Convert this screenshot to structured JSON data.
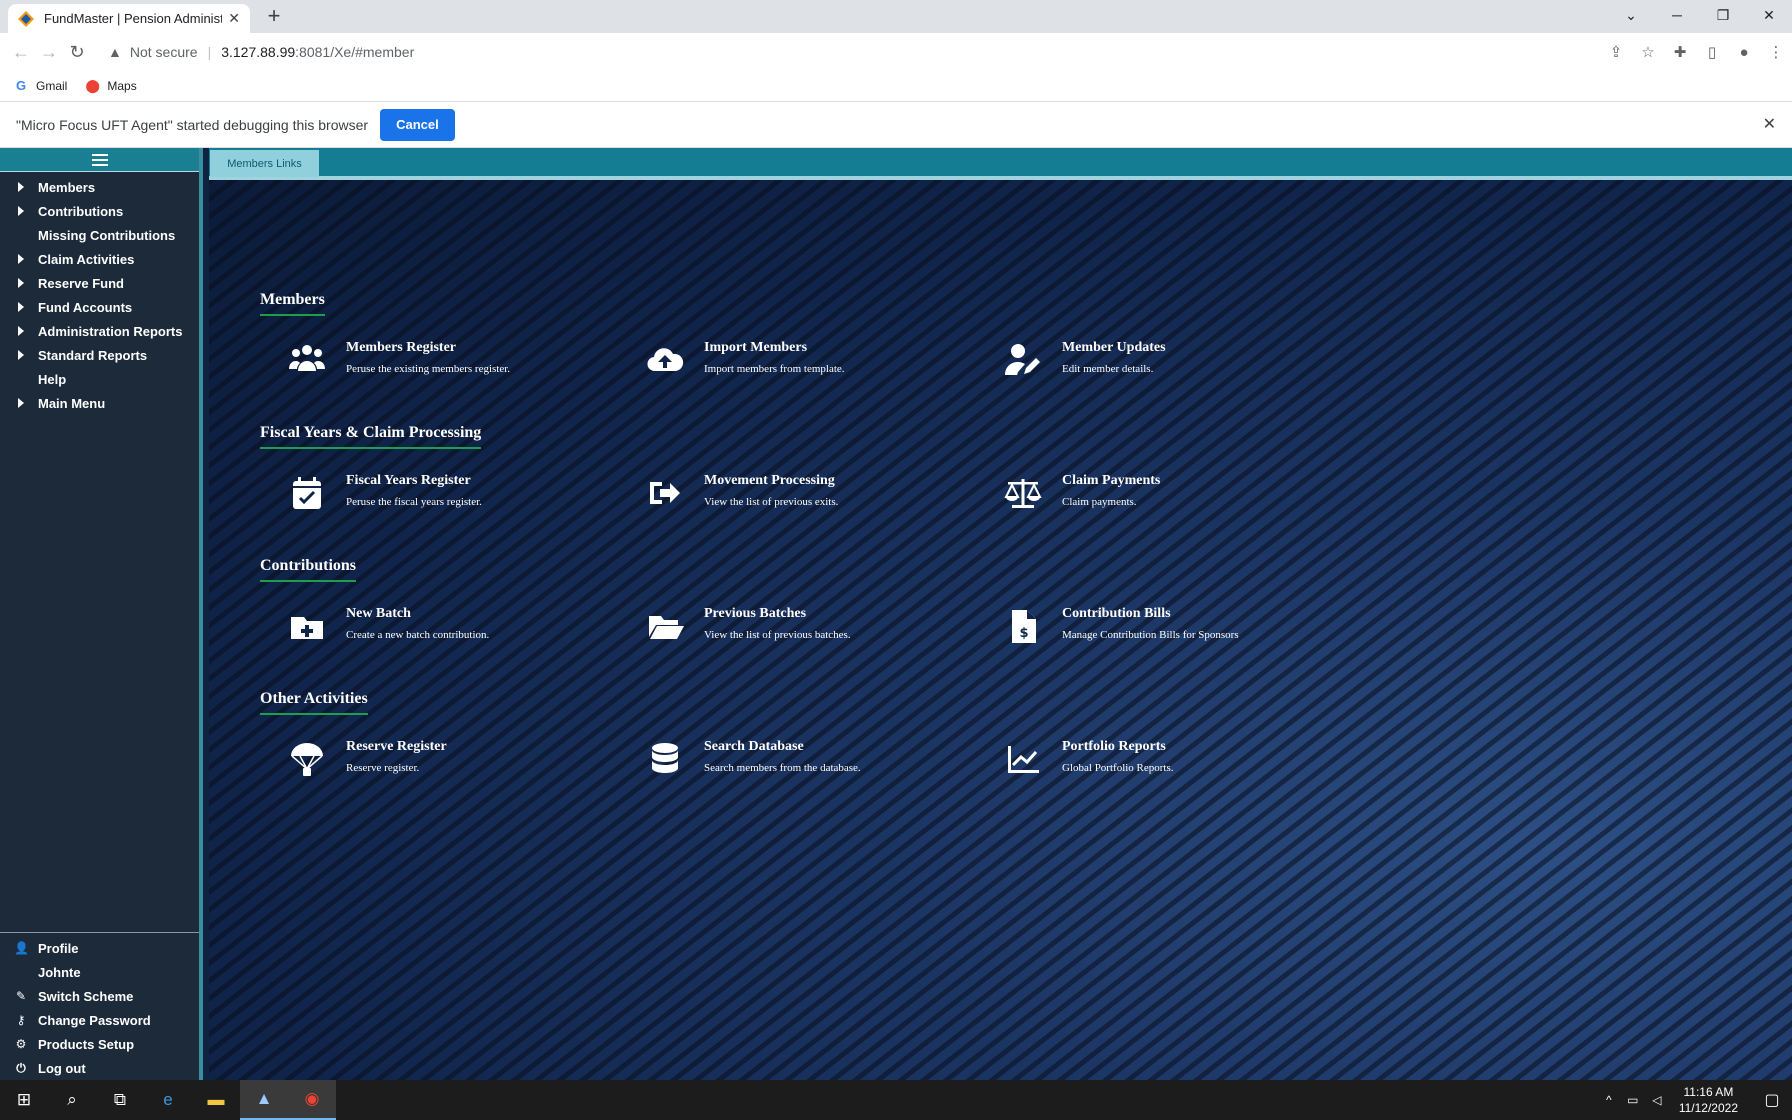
{
  "browser": {
    "tab_title": "FundMaster | Pension Administra",
    "new_tab": "+",
    "url_not_secure": "Not secure",
    "url_host": "3.127.88.99",
    "url_rest": ":8081/Xe/#member",
    "bookmarks": [
      {
        "label": "Gmail",
        "icon": "google-icon"
      },
      {
        "label": "Maps",
        "icon": "maps-pin-icon"
      }
    ],
    "infobar_text": "\"Micro Focus UFT Agent\" started debugging this browser",
    "infobar_cancel": "Cancel"
  },
  "sidebar": {
    "items": [
      {
        "label": "Members",
        "expandable": true
      },
      {
        "label": "Contributions",
        "expandable": true
      },
      {
        "label": "Missing Contributions",
        "expandable": false
      },
      {
        "label": "Claim Activities",
        "expandable": true
      },
      {
        "label": "Reserve Fund",
        "expandable": true
      },
      {
        "label": "Fund Accounts",
        "expandable": true
      },
      {
        "label": "Administration Reports",
        "expandable": true
      },
      {
        "label": "Standard Reports",
        "expandable": true
      },
      {
        "label": "Help",
        "expandable": false
      },
      {
        "label": "Main Menu",
        "expandable": true
      }
    ],
    "bottom": [
      {
        "label": "Profile",
        "icon": "user-icon"
      },
      {
        "label": "Johnte",
        "icon": ""
      },
      {
        "label": "Switch Scheme",
        "icon": "switch-icon"
      },
      {
        "label": "Change Password",
        "icon": "key-icon"
      },
      {
        "label": "Products Setup",
        "icon": "gears-icon"
      },
      {
        "label": "Log out",
        "icon": "power-icon"
      }
    ]
  },
  "main": {
    "tab_label": "Members Links",
    "sections": [
      {
        "title": "Members",
        "cards": [
          {
            "title": "Members Register",
            "desc": "Peruse the existing members register.",
            "icon": "users-icon"
          },
          {
            "title": "Import Members",
            "desc": "Import members from template.",
            "icon": "cloud-upload-icon"
          },
          {
            "title": "Member Updates",
            "desc": "Edit member details.",
            "icon": "user-edit-icon"
          }
        ]
      },
      {
        "title": "Fiscal Years & Claim Processing",
        "cards": [
          {
            "title": "Fiscal Years Register",
            "desc": "Peruse the fiscal years register.",
            "icon": "calendar-check-icon"
          },
          {
            "title": "Movement Processing",
            "desc": "View the list of previous exits.",
            "icon": "sign-out-icon"
          },
          {
            "title": "Claim Payments",
            "desc": "Claim payments.",
            "icon": "balance-scale-icon"
          }
        ]
      },
      {
        "title": "Contributions",
        "cards": [
          {
            "title": "New Batch",
            "desc": "Create a new batch contribution.",
            "icon": "folder-plus-icon"
          },
          {
            "title": "Previous Batches",
            "desc": "View the list of previous batches.",
            "icon": "folder-open-icon"
          },
          {
            "title": "Contribution Bills",
            "desc": "Manage Contribution Bills for Sponsors",
            "icon": "file-invoice-dollar-icon"
          }
        ]
      },
      {
        "title": "Other Activities",
        "cards": [
          {
            "title": "Reserve Register",
            "desc": "Reserve register.",
            "icon": "parachute-icon"
          },
          {
            "title": "Search Database",
            "desc": "Search members from the database.",
            "icon": "database-icon"
          },
          {
            "title": "Portfolio Reports",
            "desc": "Global Portfolio Reports.",
            "icon": "chart-line-icon"
          }
        ]
      }
    ]
  },
  "taskbar": {
    "time": "11:16 AM",
    "date": "11/12/2022"
  }
}
